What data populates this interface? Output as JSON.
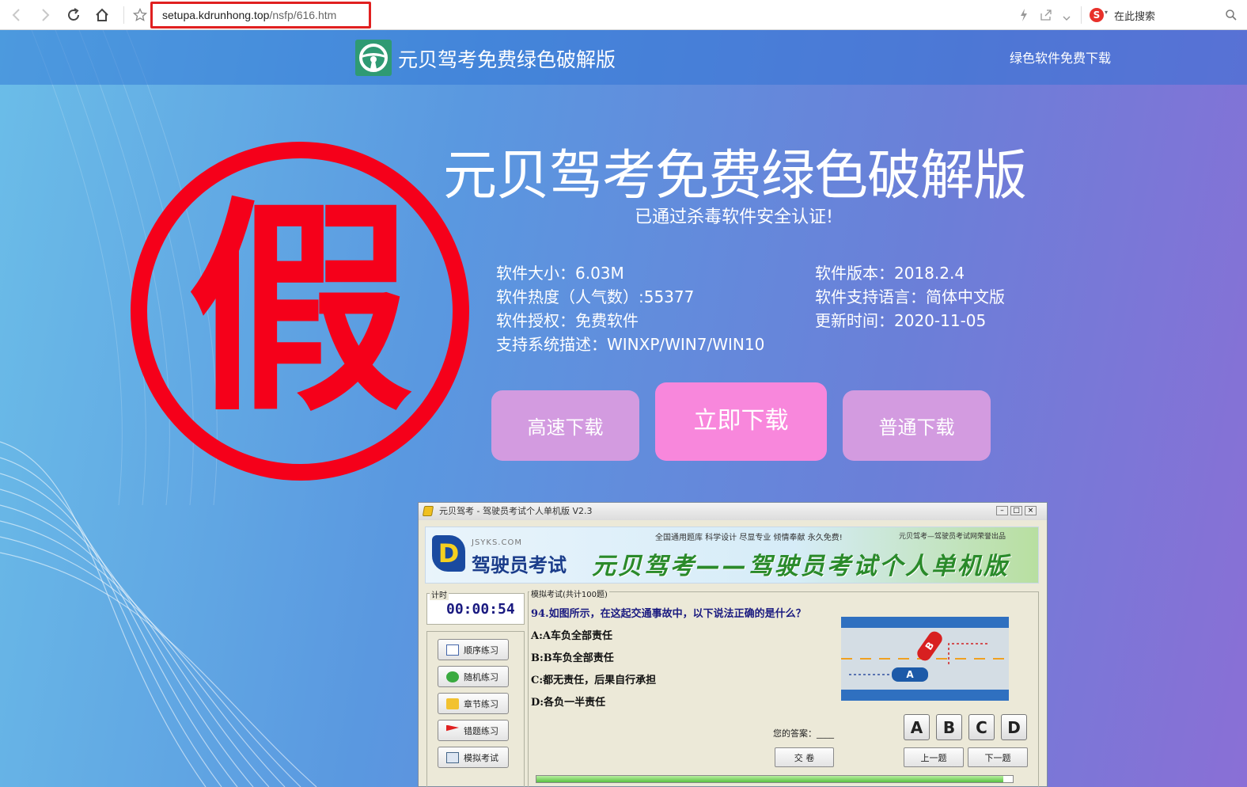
{
  "browser": {
    "url_host": "setupa.kdrunhong.top",
    "url_path": "/nsfp/616.htm",
    "search_placeholder": "在此搜索"
  },
  "header": {
    "site_name": "元贝驾考免费绿色破解版",
    "link": "绿色软件免费下载"
  },
  "hero": {
    "title": "元贝驾考免费绿色破解版",
    "subtitle": "已通过杀毒软件安全认证!",
    "info_left": [
      "软件大小：6.03M",
      "软件热度（人气数）:55377",
      "软件授权：免费软件",
      "支持系统描述：WINXP/WIN7/WIN10"
    ],
    "info_right": [
      "软件版本：2018.2.4",
      "软件支持语言：简体中文版",
      "更新时间：2020-11-05"
    ],
    "btn_fast": "高速下载",
    "btn_now": "立即下载",
    "btn_normal": "普通下载"
  },
  "stamp": {
    "char": "假",
    "color": "#f5001a"
  },
  "app": {
    "title": "元贝驾考 - 驾驶员考试个人单机版 V2.3",
    "banner_jsyks": "JSYKS.COM",
    "banner_logo_text": "驾驶员考试",
    "banner_slogan": "全国通用题库  科学设计  尽显专业  倾情奉献  永久免费!",
    "banner_maker": "元贝驾考—驾驶员考试网荣誉出品",
    "banner_title": "元贝驾考——驾驶员考试个人单机版",
    "timer_label": "计时",
    "timer": "00:00:54",
    "modes": [
      "顺序练习",
      "随机练习",
      "章节练习",
      "错题练习",
      "模拟考试"
    ],
    "exam_label": "模拟考试(共计100题)",
    "question": "94.如图所示，在这起交通事故中，以下说法正确的是什么？",
    "options": [
      "A:A车负全部责任",
      "B:B车负全部责任",
      "C:都无责任，后果自行承担",
      "D:各负一半责任"
    ],
    "answer_label": "您的答案：____",
    "submit": "交  卷",
    "answers": [
      "A",
      "B",
      "C",
      "D"
    ],
    "prev": "上一题",
    "next": "下一题",
    "car_a": "A",
    "car_b": "B"
  },
  "colors": {
    "accent": "#5a98e0",
    "btn_purple": "#d39be0",
    "btn_pink": "#f887dc",
    "stamp_red": "#f5001a"
  }
}
